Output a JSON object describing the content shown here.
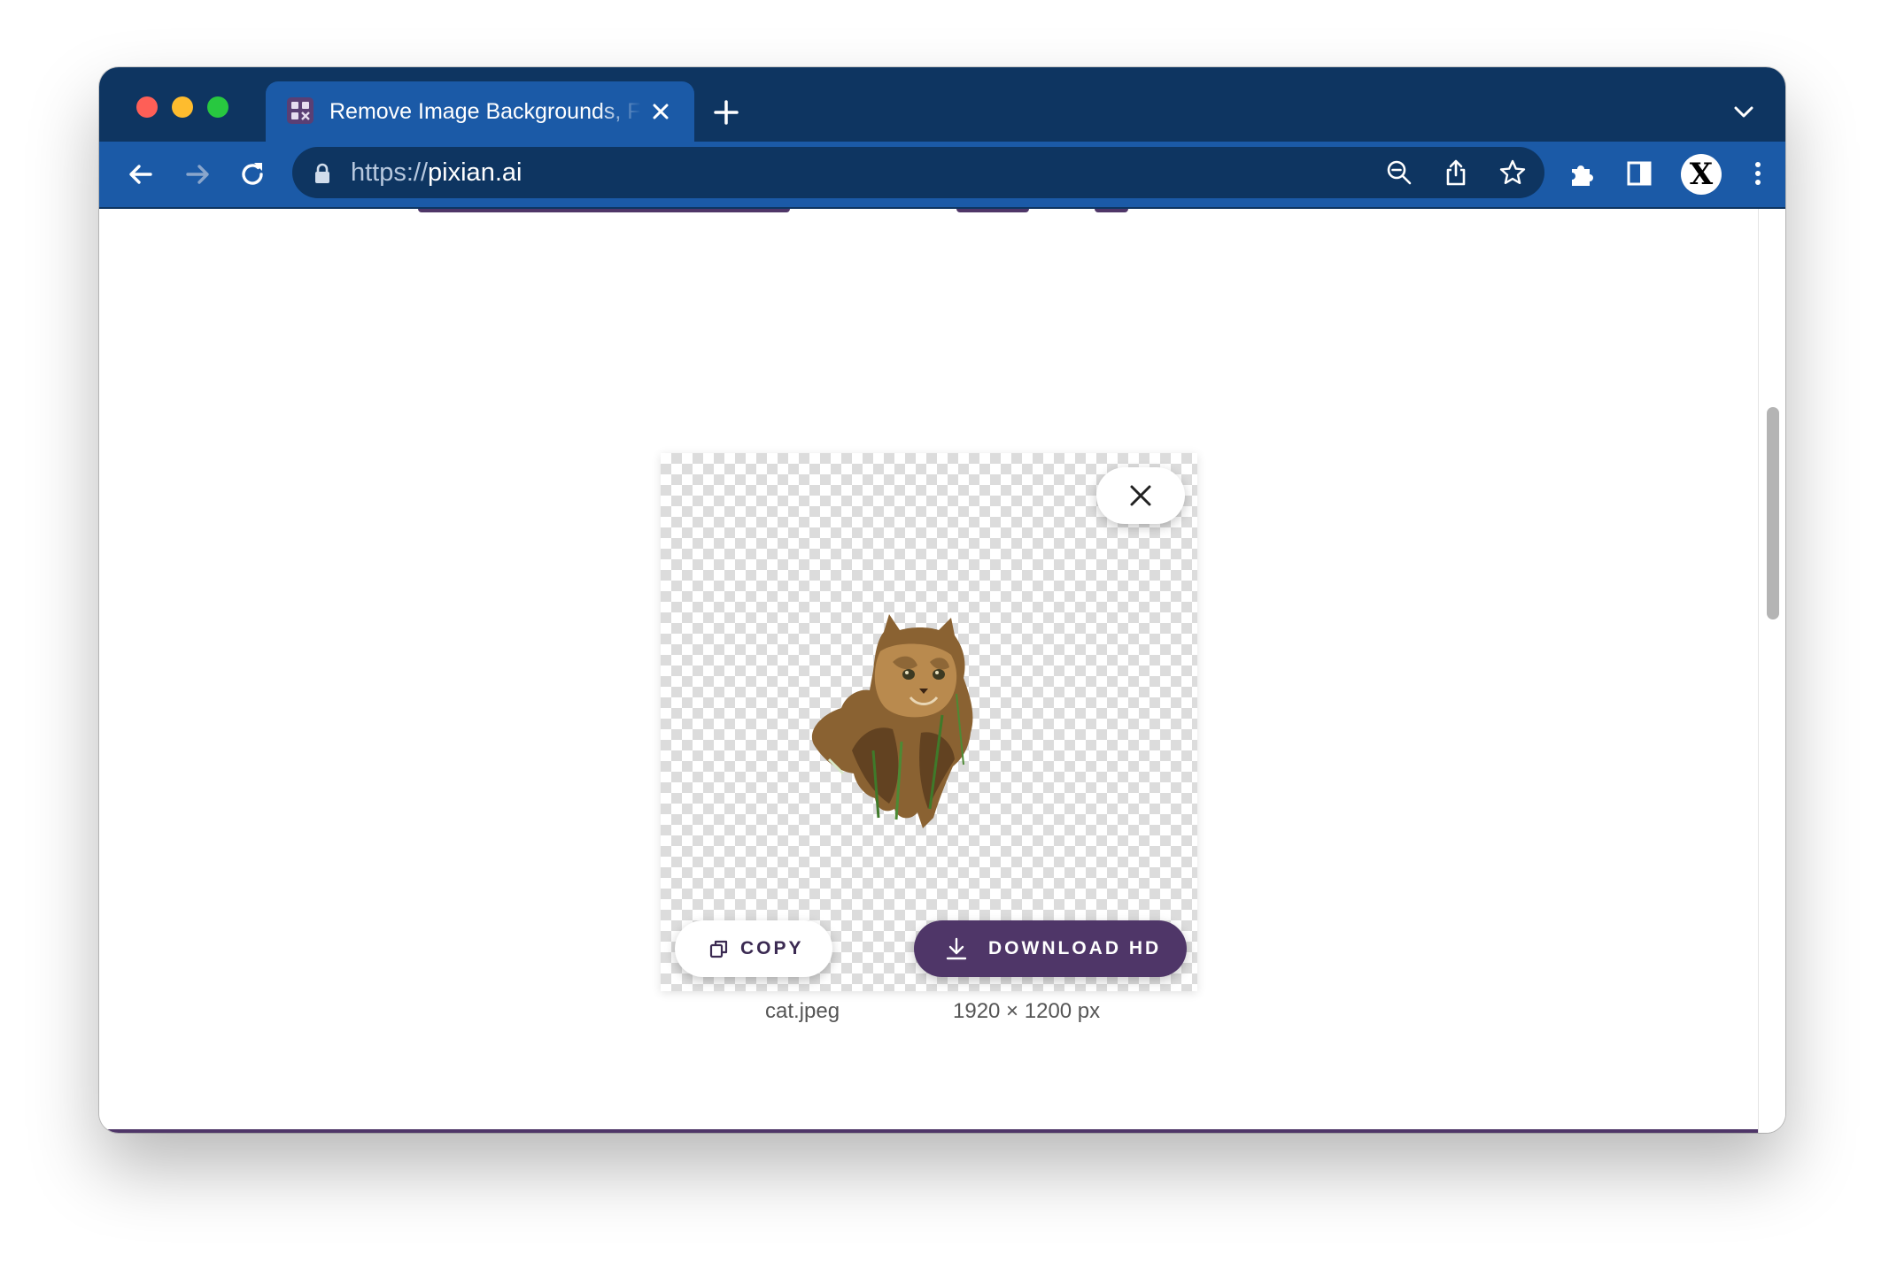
{
  "browser": {
    "tab": {
      "title": "Remove Image Backgrounds, Free",
      "favicon": "pixian-grid-icon"
    },
    "toolbar": {
      "url_scheme": "https://",
      "url_host": "pixian.ai",
      "icons": [
        "back-arrow-icon",
        "forward-arrow-icon",
        "reload-icon",
        "lock-icon",
        "zoom-out-icon",
        "share-icon",
        "star-icon",
        "extensions-puzzle-icon",
        "side-panel-icon",
        "kebab-menu-icon"
      ]
    },
    "profile": {
      "avatar_letter": "X"
    }
  },
  "result": {
    "image_subject": "cat",
    "copy_label": "COPY",
    "download_label": "DOWNLOAD HD",
    "filename": "cat.jpeg",
    "dimensions": "1920 × 1200 px"
  },
  "colors": {
    "tabbar": "#0e3561",
    "toolbar": "#1b5aa7",
    "brand_purple": "#4f3668"
  }
}
